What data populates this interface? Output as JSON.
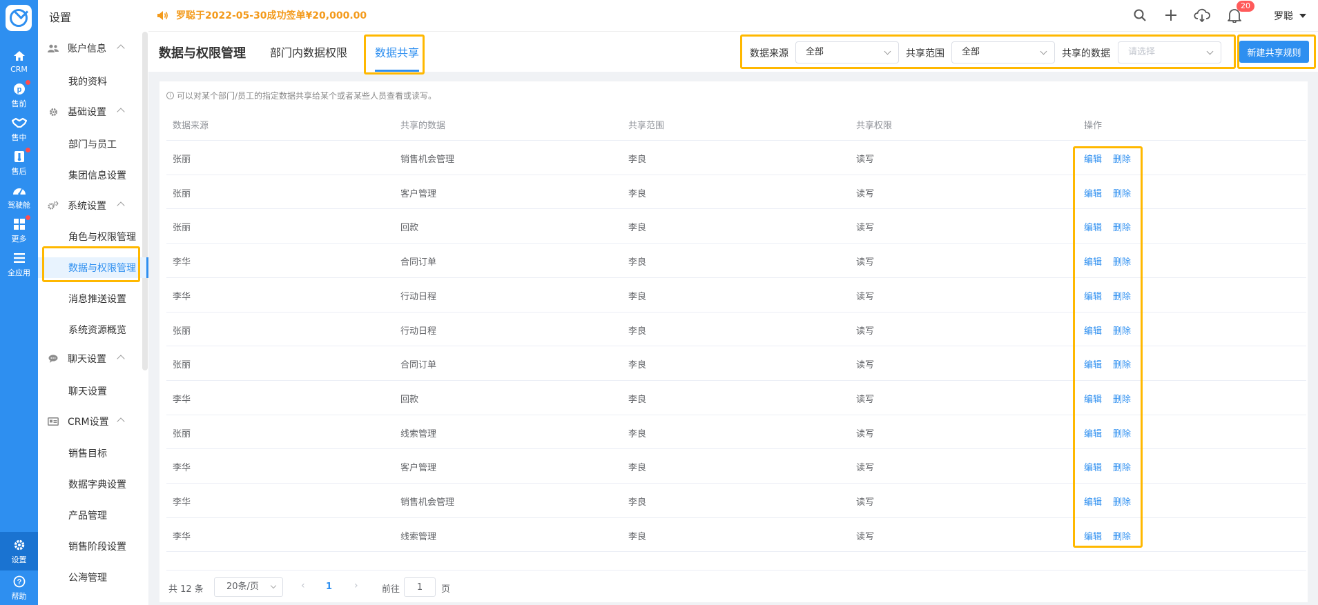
{
  "rail": {
    "items": [
      {
        "label": "CRM",
        "icon": "home-icon",
        "dot": false
      },
      {
        "label": "售前",
        "icon": "pinterest-icon",
        "dot": true
      },
      {
        "label": "售中",
        "icon": "handshake-icon",
        "dot": false
      },
      {
        "label": "售后",
        "icon": "thermometer-icon",
        "dot": true
      },
      {
        "label": "驾驶舱",
        "icon": "dashboard-icon",
        "dot": false
      },
      {
        "label": "更多",
        "icon": "grid-icon",
        "dot": true
      },
      {
        "label": "全应用",
        "icon": "list-icon",
        "dot": false
      }
    ],
    "settings_label": "设置",
    "help_label": "帮助"
  },
  "sidebar": {
    "title": "设置",
    "groups": [
      {
        "label": "账户信息",
        "icon": "users-icon",
        "items": [
          "我的资料"
        ]
      },
      {
        "label": "基础设置",
        "icon": "gear-icon",
        "items": [
          "部门与员工",
          "集团信息设置"
        ]
      },
      {
        "label": "系统设置",
        "icon": "gears-icon",
        "items": [
          "角色与权限管理",
          "数据与权限管理",
          "消息推送设置",
          "系统资源概览"
        ]
      },
      {
        "label": "聊天设置",
        "icon": "chat-icon",
        "items": [
          "聊天设置"
        ]
      },
      {
        "label": "CRM设置",
        "icon": "card-icon",
        "items": [
          "销售目标",
          "数据字典设置",
          "产品管理",
          "销售阶段设置",
          "公海管理"
        ]
      }
    ],
    "active_item": "数据与权限管理"
  },
  "topbar": {
    "notice": "罗聪于2022-05-30成功签单¥20,000.00",
    "badge_count": "20",
    "user_name": "罗聪"
  },
  "header": {
    "title": "数据与权限管理",
    "tabs": [
      "部门内数据权限",
      "数据共享"
    ],
    "active_tab": "数据共享",
    "filters": [
      {
        "label": "数据来源",
        "value": "全部"
      },
      {
        "label": "共享范围",
        "value": "全部"
      },
      {
        "label": "共享的数据",
        "placeholder": "请选择"
      }
    ],
    "new_button": "新建共享规则"
  },
  "table": {
    "hint": "可以对某个部门/员工的指定数据共享给某个或者某些人员查看或读写。",
    "columns": [
      "数据来源",
      "共享的数据",
      "共享范围",
      "共享权限",
      "操作"
    ],
    "edit_label": "编辑",
    "delete_label": "删除",
    "rows": [
      [
        "张丽",
        "销售机会管理",
        "李良",
        "读写"
      ],
      [
        "张丽",
        "客户管理",
        "李良",
        "读写"
      ],
      [
        "张丽",
        "回款",
        "李良",
        "读写"
      ],
      [
        "李华",
        "合同订单",
        "李良",
        "读写"
      ],
      [
        "李华",
        "行动日程",
        "李良",
        "读写"
      ],
      [
        "张丽",
        "行动日程",
        "李良",
        "读写"
      ],
      [
        "张丽",
        "合同订单",
        "李良",
        "读写"
      ],
      [
        "李华",
        "回款",
        "李良",
        "读写"
      ],
      [
        "张丽",
        "线索管理",
        "李良",
        "读写"
      ],
      [
        "李华",
        "客户管理",
        "李良",
        "读写"
      ],
      [
        "李华",
        "销售机会管理",
        "李良",
        "读写"
      ],
      [
        "李华",
        "线索管理",
        "李良",
        "读写"
      ]
    ]
  },
  "pagination": {
    "total": "共 12 条",
    "page_size": "20条/页",
    "current": "1",
    "goto_label": "前往",
    "goto_value": "1",
    "page_suffix": "页"
  },
  "colors": {
    "primary": "#2e8ff0",
    "highlight": "#ffb800",
    "notice": "#f39a1b"
  }
}
